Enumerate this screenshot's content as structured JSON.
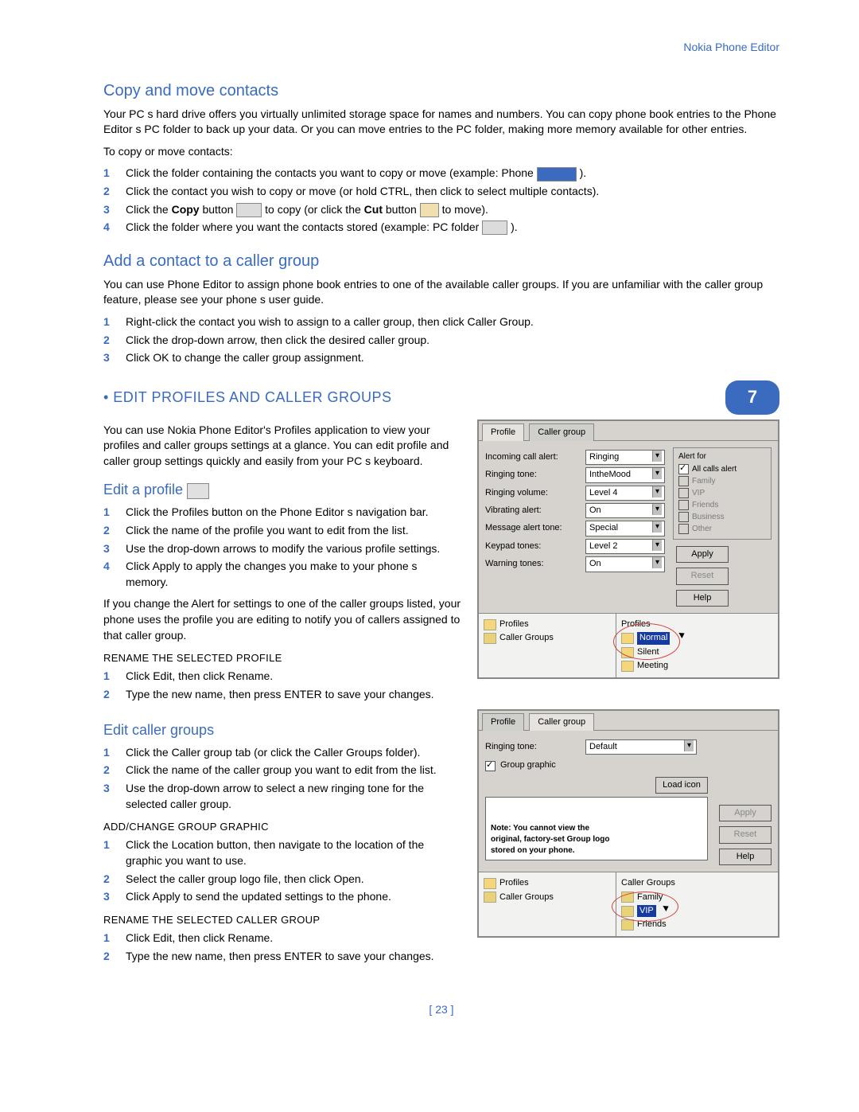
{
  "header": {
    "product": "Nokia Phone Editor"
  },
  "chapter_number": "7",
  "page_number": "[ 23 ]",
  "s1": {
    "title": "Copy and move contacts",
    "intro": "Your PC s hard drive offers you virtually unlimited storage space for names and numbers. You can copy phone book entries to the Phone Editor s PC folder to back up your data. Or you can move entries to the PC folder, making more memory available for other entries.",
    "lead": "To copy or move contacts:",
    "steps": [
      "Click the folder containing the contacts you want to copy or move (example: Phone",
      "Click the contact you wish to copy or move (or hold CTRL, then click to select multiple contacts).",
      "Click the Copy button to copy (or click the Cut button to move).",
      "Click the folder where you want the contacts stored (example: PC folder )."
    ]
  },
  "s2": {
    "title": "Add a contact to a caller group",
    "intro": "You can use Phone Editor to assign phone book entries to one of the available caller groups. If you are unfamiliar with the caller group feature, please see your phone s user guide.",
    "steps": [
      "Right-click the contact you wish to assign to a caller group, then click Caller Group.",
      "Click the drop-down arrow, then click the desired caller group.",
      "Click OK to change the caller group assignment."
    ]
  },
  "section7_title": " • EDIT PROFILES AND CALLER GROUPS",
  "s3_intro": "You can use Nokia Phone Editor's Profiles application to view your profiles and caller groups settings at a glance. You can edit profile and caller group settings quickly and easily from your PC s keyboard.",
  "s3": {
    "title": "Edit a profile",
    "steps": [
      "Click the Profiles button on the Phone Editor s navigation bar.",
      "Click the name of the profile you want to edit from the list.",
      "Use the drop-down arrows to modify the various profile settings.",
      "Click Apply to apply the changes you make to your phone s memory."
    ],
    "after": "If you change the Alert for settings to one of the caller groups listed, your phone uses the profile you are editing to notify you of callers assigned to that caller group.",
    "rename_title": "RENAME THE SELECTED PROFILE",
    "rename_steps": [
      "Click Edit, then click Rename.",
      "Type the new name, then press ENTER to save your changes."
    ]
  },
  "s4": {
    "title": "Edit caller groups",
    "steps": [
      "Click the Caller group tab (or click the Caller Groups folder).",
      "Click the name of the caller group you want to edit from the list.",
      "Use the drop-down arrow to select a new ringing tone for the selected caller group."
    ],
    "add_title": "ADD/CHANGE GROUP GRAPHIC",
    "add_steps": [
      "Click the Location button, then navigate to the location of the graphic you want to use.",
      "Select the caller group logo file, then click Open.",
      "Click Apply to send the updated settings to the phone."
    ],
    "rename_title": "RENAME THE SELECTED CALLER GROUP",
    "rename_steps": [
      "Click Edit, then click Rename.",
      "Type the new name, then press ENTER to save your changes."
    ]
  },
  "panelA": {
    "tab1": "Profile",
    "tab2": "Caller group",
    "rows": {
      "incoming": "Incoming call alert:",
      "incoming_v": "Ringing",
      "rtone": "Ringing tone:",
      "rtone_v": "IntheMood",
      "rvol": "Ringing volume:",
      "rvol_v": "Level 4",
      "vib": "Vibrating alert:",
      "vib_v": "On",
      "msg": "Message alert tone:",
      "msg_v": "Special",
      "key": "Keypad tones:",
      "key_v": "Level 2",
      "warn": "Warning tones:",
      "warn_v": "On"
    },
    "alert_title": "Alert for",
    "alert_all": "All calls alert",
    "alert_items": [
      "Family",
      "VIP",
      "Friends",
      "Business",
      "Other"
    ],
    "btn_apply": "Apply",
    "btn_reset": "Reset",
    "btn_help": "Help",
    "tree_left": [
      "Profiles",
      "Caller Groups"
    ],
    "tree_right_title": "Profiles",
    "tree_right": [
      "Normal",
      "Silent",
      "Meeting"
    ]
  },
  "panelB": {
    "tab1": "Profile",
    "tab2": "Caller group",
    "rtone": "Ringing tone:",
    "rtone_v": "Default",
    "grp_graphic": "Group graphic",
    "load": "Load icon",
    "note": "Note: You cannot view the original, factory-set Group logo stored on your phone.",
    "btn_apply": "Apply",
    "btn_reset": "Reset",
    "btn_help": "Help",
    "tree_left": [
      "Profiles",
      "Caller Groups"
    ],
    "tree_right_title": "Caller Groups",
    "tree_right": [
      "Family",
      "VIP",
      "Friends"
    ]
  }
}
